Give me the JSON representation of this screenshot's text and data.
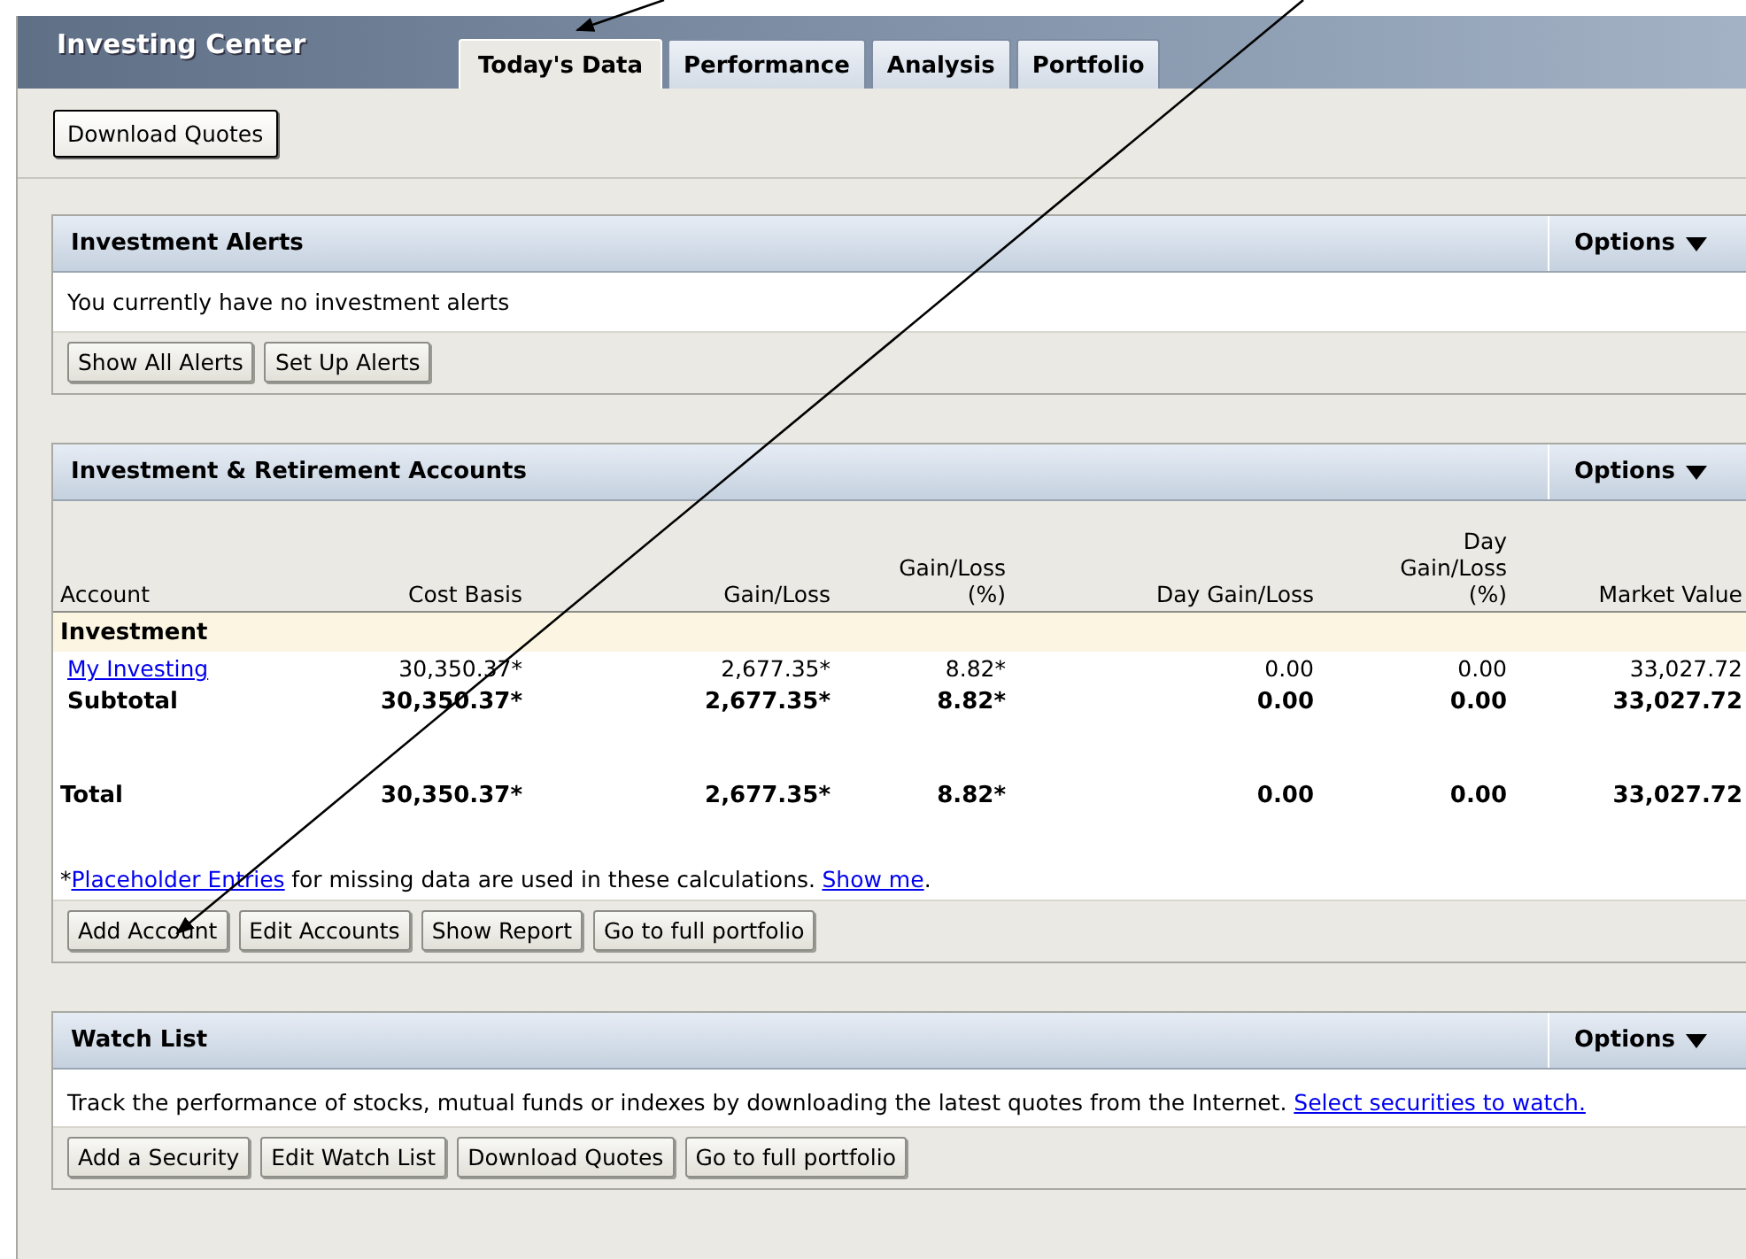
{
  "header": {
    "title": "Investing Center"
  },
  "tabs": [
    {
      "label": "Today's Data",
      "selected": true
    },
    {
      "label": "Performance",
      "selected": false
    },
    {
      "label": "Analysis",
      "selected": false
    },
    {
      "label": "Portfolio",
      "selected": false
    }
  ],
  "toolbar": {
    "buttons": [
      "Download Quotes"
    ]
  },
  "alerts": {
    "title": "Investment Alerts",
    "options": "Options",
    "message": "You currently have no investment alerts",
    "buttons": [
      "Show All Alerts",
      "Set Up Alerts"
    ]
  },
  "accounts": {
    "title": "Investment & Retirement Accounts",
    "options": "Options",
    "columns": [
      "Account",
      "Cost Basis",
      "Gain/Loss",
      "Gain/Loss (%)",
      "Day Gain/Loss",
      "Day Gain/Loss (%)",
      "Market Value"
    ],
    "rows": [
      {
        "kind": "group",
        "cells": [
          "Investment"
        ]
      },
      {
        "kind": "account",
        "cells": [
          "My Investing",
          "30,350.37*",
          "2,677.35*",
          "8.82*",
          "0.00",
          "0.00",
          "33,027.72"
        ]
      },
      {
        "kind": "subtotal",
        "cells": [
          "Subtotal",
          "30,350.37*",
          "2,677.35*",
          "8.82*",
          "0.00",
          "0.00",
          "33,027.72"
        ]
      },
      {
        "kind": "total",
        "cells": [
          "Total",
          "30,350.37*",
          "2,677.35*",
          "8.82*",
          "0.00",
          "0.00",
          "33,027.72"
        ]
      }
    ],
    "note": {
      "mark": "*",
      "link": "Placeholder Entries",
      "text": "for missing data are used in these calculations.",
      "link2": "Show me",
      "end": "."
    },
    "buttons": [
      "Add Account",
      "Edit Accounts",
      "Show Report",
      "Go to full portfolio"
    ]
  },
  "watch": {
    "title": "Watch List",
    "options": "Options",
    "message": "Track the performance of stocks, mutual funds or indexes by downloading the latest quotes from the Internet.",
    "link": "Select securities to watch.",
    "buttons": [
      "Add a Security",
      "Edit Watch List",
      "Download Quotes",
      "Go to full portfolio"
    ]
  }
}
